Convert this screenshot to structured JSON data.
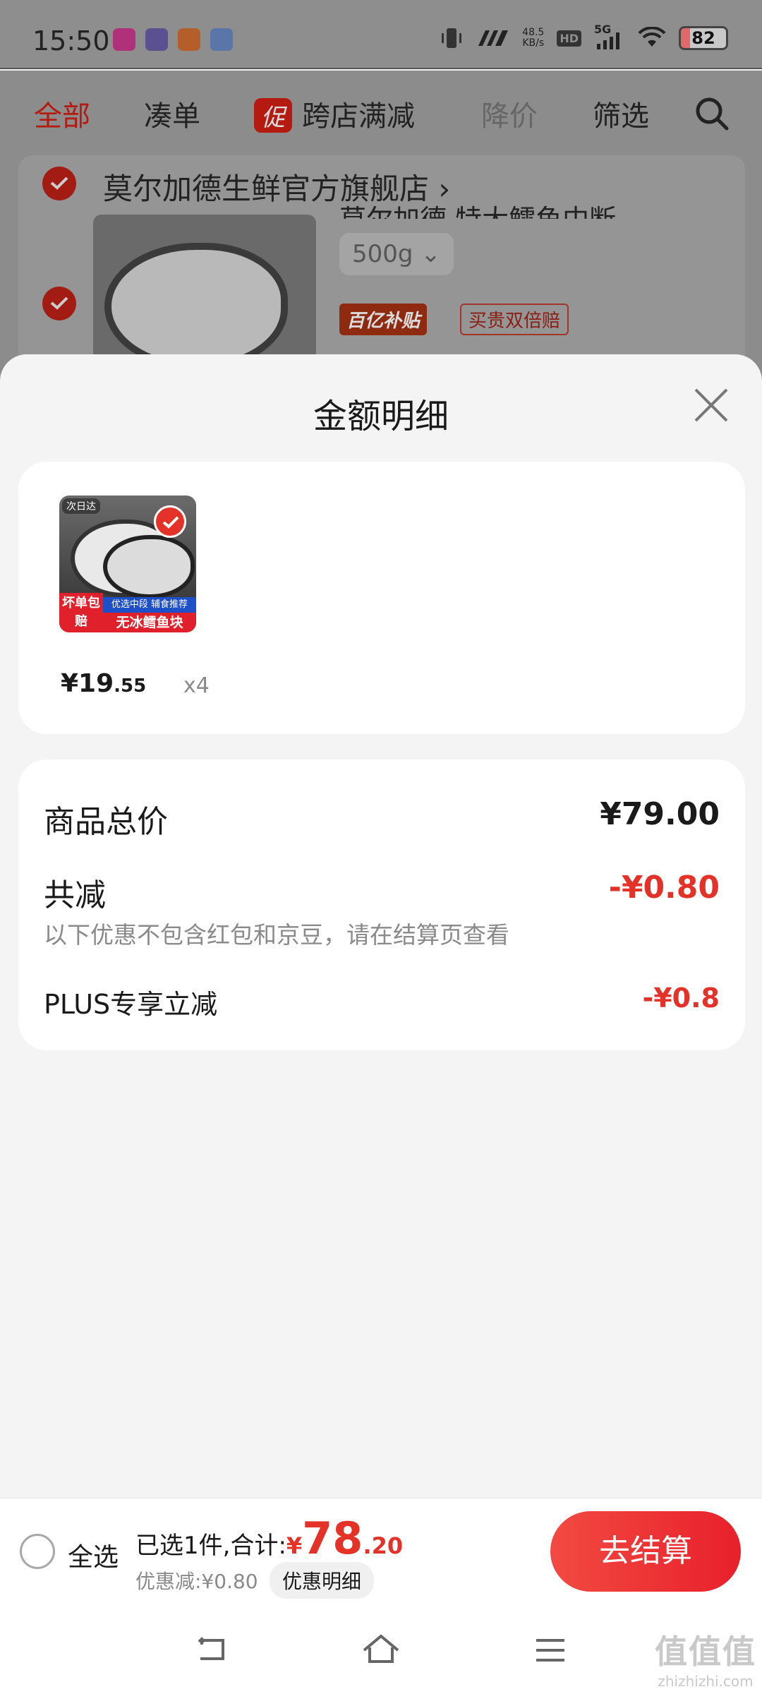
{
  "status_bar": {
    "time": "15:50",
    "net_speed_value": "48.5",
    "net_speed_unit": "KB/s",
    "hd": "HD",
    "network": "5G",
    "battery": "82",
    "app_colors": [
      "#e6007e",
      "#5a47b8",
      "#ff6a00",
      "#2f6fe0"
    ]
  },
  "cart_tabs": {
    "all": "全部",
    "bundle": "凑单",
    "promo_badge": "促",
    "cross_store": "跨店满减",
    "price_drop": "降价",
    "filter": "筛选"
  },
  "cart_store": {
    "name": "莫尔加德生鲜官方旗舰店",
    "chevron": "›",
    "product_title": "莫尔加德 特大鳕鱼中断",
    "spec": "500g",
    "tag_subsidy": "百亿补贴",
    "tag_guarantee": "买贵双倍赔"
  },
  "sheet": {
    "title": "金额明细",
    "item": {
      "thumb_top": "次日达",
      "thumb_left": "坏单包赔",
      "thumb_sub": "优选中段 辅食推荐",
      "thumb_main": "无冰鳕鱼块",
      "price_main": "¥19",
      "price_cents": ".55",
      "qty": "x4"
    },
    "rows": {
      "total_label": "商品总价",
      "total_value": "¥79.00",
      "discount_label": "共减",
      "discount_value": "-¥0.80",
      "discount_note": "以下优惠不包含红包和京豆，请在结算页查看",
      "plus_label": "PLUS专享立减",
      "plus_value": "-¥0.8"
    }
  },
  "action_bar": {
    "select_all": "全选",
    "selected_text": "已选1件,合计:",
    "currency": "¥",
    "amount_main": "78",
    "amount_cents": ".20",
    "discount_text": "优惠减:¥0.80",
    "detail_chip": "优惠明细",
    "checkout": "去结算"
  },
  "watermark": {
    "line1": "值值值",
    "line2": "zhizhizhi.com"
  },
  "colors": {
    "accent_red": "#e53228",
    "brand_dark_red": "#b51a10",
    "text_primary": "#1a1a1a",
    "text_secondary": "#8a8a8a"
  }
}
